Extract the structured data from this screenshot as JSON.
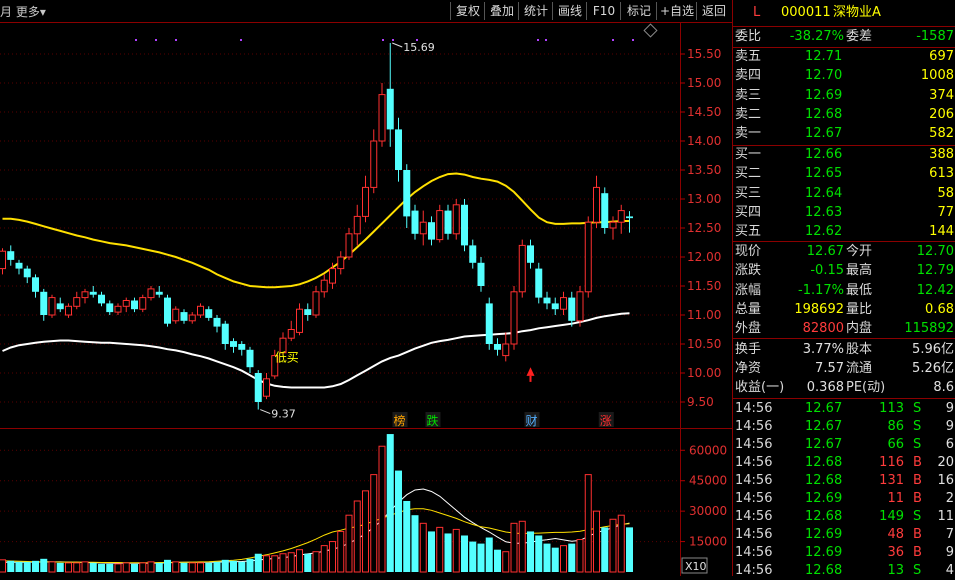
{
  "toolbar": {
    "left_fragment": "月",
    "more": "更多",
    "buttons": [
      "复权",
      "叠加",
      "统计",
      "画线",
      "F10",
      "标记",
      "+自选",
      "返回"
    ]
  },
  "stock": {
    "flag": "L",
    "code": "000011",
    "name": "深物业A"
  },
  "weibi": {
    "label": "委比",
    "value": "-38.27%",
    "label2": "委差",
    "value2": "-1587"
  },
  "asks": [
    {
      "label": "卖五",
      "price": "12.71",
      "vol": "697"
    },
    {
      "label": "卖四",
      "price": "12.70",
      "vol": "1008"
    },
    {
      "label": "卖三",
      "price": "12.69",
      "vol": "374"
    },
    {
      "label": "卖二",
      "price": "12.68",
      "vol": "206"
    },
    {
      "label": "卖一",
      "price": "12.67",
      "vol": "582"
    }
  ],
  "bids": [
    {
      "label": "买一",
      "price": "12.66",
      "vol": "388"
    },
    {
      "label": "买二",
      "price": "12.65",
      "vol": "613"
    },
    {
      "label": "买三",
      "price": "12.64",
      "vol": "58"
    },
    {
      "label": "买四",
      "price": "12.63",
      "vol": "77"
    },
    {
      "label": "买五",
      "price": "12.62",
      "vol": "144"
    }
  ],
  "quote": [
    {
      "l1": "现价",
      "v1": "12.67",
      "c1": "g",
      "l2": "今开",
      "v2": "12.70",
      "c2": "g"
    },
    {
      "l1": "涨跌",
      "v1": "-0.15",
      "c1": "g",
      "l2": "最高",
      "v2": "12.79",
      "c2": "g"
    },
    {
      "l1": "涨幅",
      "v1": "-1.17%",
      "c1": "g",
      "l2": "最低",
      "v2": "12.42",
      "c2": "g"
    },
    {
      "l1": "总量",
      "v1": "198692",
      "c1": "y",
      "l2": "量比",
      "v2": "0.68",
      "c2": "y"
    },
    {
      "l1": "外盘",
      "v1": "82800",
      "c1": "r",
      "l2": "内盘",
      "v2": "115892",
      "c2": "g"
    }
  ],
  "stats": [
    {
      "l1": "换手",
      "v1": "3.77%",
      "l2": "股本",
      "v2": "5.96亿"
    },
    {
      "l1": "净资",
      "v1": "7.57",
      "l2": "流通",
      "v2": "5.26亿"
    },
    {
      "l1": "收益(一)",
      "v1": "0.368",
      "l2": "PE(动)",
      "v2": "8.6"
    }
  ],
  "ticks": [
    {
      "t": "14:56",
      "p": "12.67",
      "v": "113",
      "s": "S",
      "n": "9"
    },
    {
      "t": "14:56",
      "p": "12.67",
      "v": "86",
      "s": "S",
      "n": "9"
    },
    {
      "t": "14:56",
      "p": "12.67",
      "v": "66",
      "s": "S",
      "n": "6"
    },
    {
      "t": "14:56",
      "p": "12.68",
      "v": "116",
      "s": "B",
      "n": "20"
    },
    {
      "t": "14:56",
      "p": "12.68",
      "v": "131",
      "s": "B",
      "n": "16"
    },
    {
      "t": "14:56",
      "p": "12.69",
      "v": "11",
      "s": "B",
      "n": "2"
    },
    {
      "t": "14:56",
      "p": "12.68",
      "v": "149",
      "s": "S",
      "n": "11"
    },
    {
      "t": "14:56",
      "p": "12.69",
      "v": "48",
      "s": "B",
      "n": "7"
    },
    {
      "t": "14:56",
      "p": "12.69",
      "v": "36",
      "s": "B",
      "n": "9"
    },
    {
      "t": "14:56",
      "p": "12.68",
      "v": "13",
      "s": "S",
      "n": "4"
    }
  ],
  "chart_data": {
    "type": "candlestick",
    "price_ylim": [
      9.3,
      15.8
    ],
    "price_ticks": [
      "15.50",
      "15.00",
      "14.50",
      "14.00",
      "13.50",
      "13.00",
      "12.50",
      "12.00",
      "11.50",
      "11.00",
      "10.50",
      "10.00",
      "9.50"
    ],
    "volume_ylim": [
      0,
      70000
    ],
    "volume_ticks": [
      "60000",
      "45000",
      "30000",
      "15000"
    ],
    "volume_unit": "X10",
    "high_annotation": "15.69",
    "low_annotation": "9.37",
    "signal_label": "低买",
    "event_markers": [
      "榜",
      "跌",
      "财",
      "涨"
    ],
    "candles": [
      [
        11.8,
        12.1,
        11.7,
        12.15
      ],
      [
        12.1,
        11.95,
        11.85,
        12.2
      ],
      [
        11.9,
        11.8,
        11.7,
        11.95
      ],
      [
        11.8,
        11.65,
        11.55,
        11.85
      ],
      [
        11.65,
        11.4,
        11.3,
        11.7
      ],
      [
        11.4,
        11.0,
        10.9,
        11.45
      ],
      [
        11.0,
        11.3,
        10.95,
        11.35
      ],
      [
        11.2,
        11.1,
        11.05,
        11.3
      ],
      [
        11.0,
        11.15,
        10.95,
        11.2
      ],
      [
        11.15,
        11.3,
        11.1,
        11.4
      ],
      [
        11.3,
        11.4,
        11.2,
        11.45
      ],
      [
        11.4,
        11.35,
        11.3,
        11.5
      ],
      [
        11.35,
        11.2,
        11.15,
        11.4
      ],
      [
        11.2,
        11.05,
        11.0,
        11.25
      ],
      [
        11.05,
        11.15,
        11.0,
        11.2
      ],
      [
        11.15,
        11.25,
        11.05,
        11.3
      ],
      [
        11.25,
        11.1,
        11.05,
        11.3
      ],
      [
        11.1,
        11.3,
        11.05,
        11.35
      ],
      [
        11.3,
        11.45,
        11.25,
        11.5
      ],
      [
        11.4,
        11.35,
        11.3,
        11.5
      ],
      [
        11.3,
        10.85,
        10.8,
        11.35
      ],
      [
        10.9,
        11.1,
        10.85,
        11.15
      ],
      [
        11.05,
        10.9,
        10.85,
        11.1
      ],
      [
        10.9,
        11.0,
        10.85,
        11.05
      ],
      [
        11.0,
        11.15,
        10.95,
        11.2
      ],
      [
        11.1,
        10.95,
        10.9,
        11.15
      ],
      [
        10.95,
        10.8,
        10.7,
        11.0
      ],
      [
        10.85,
        10.5,
        10.4,
        10.9
      ],
      [
        10.55,
        10.45,
        10.35,
        10.6
      ],
      [
        10.5,
        10.4,
        10.3,
        10.55
      ],
      [
        10.4,
        10.1,
        10.0,
        10.45
      ],
      [
        10.0,
        9.5,
        9.37,
        10.05
      ],
      [
        9.6,
        9.9,
        9.55,
        10.0
      ],
      [
        9.95,
        10.3,
        9.9,
        10.4
      ],
      [
        10.35,
        10.6,
        10.3,
        10.7
      ],
      [
        10.6,
        10.75,
        10.55,
        10.9
      ],
      [
        10.7,
        11.1,
        10.65,
        11.2
      ],
      [
        11.1,
        11.0,
        10.9,
        11.2
      ],
      [
        11.0,
        11.4,
        10.95,
        11.5
      ],
      [
        11.4,
        11.6,
        11.3,
        11.7
      ],
      [
        11.55,
        11.8,
        11.45,
        11.9
      ],
      [
        11.8,
        12.0,
        11.7,
        12.1
      ],
      [
        12.0,
        12.4,
        11.95,
        12.5
      ],
      [
        12.4,
        12.7,
        12.2,
        12.9
      ],
      [
        12.7,
        13.2,
        12.6,
        13.4
      ],
      [
        13.2,
        14.0,
        13.1,
        14.2
      ],
      [
        14.0,
        14.8,
        13.9,
        15.0
      ],
      [
        14.9,
        14.2,
        13.9,
        15.69
      ],
      [
        14.2,
        13.5,
        13.3,
        14.4
      ],
      [
        13.5,
        12.7,
        12.5,
        13.6
      ],
      [
        12.8,
        12.4,
        12.3,
        12.9
      ],
      [
        12.4,
        12.6,
        12.2,
        12.8
      ],
      [
        12.6,
        12.3,
        12.2,
        12.7
      ],
      [
        12.3,
        12.8,
        12.25,
        12.9
      ],
      [
        12.8,
        12.4,
        12.3,
        12.9
      ],
      [
        12.4,
        12.9,
        12.3,
        13.0
      ],
      [
        12.9,
        12.2,
        12.1,
        13.0
      ],
      [
        12.2,
        11.9,
        11.8,
        12.3
      ],
      [
        11.9,
        11.5,
        11.4,
        12.0
      ],
      [
        11.2,
        10.5,
        10.4,
        11.3
      ],
      [
        10.5,
        10.4,
        10.3,
        10.6
      ],
      [
        10.3,
        10.5,
        10.2,
        10.7
      ],
      [
        10.5,
        11.4,
        10.4,
        11.5
      ],
      [
        11.4,
        12.2,
        11.3,
        12.3
      ],
      [
        12.2,
        11.9,
        11.8,
        12.3
      ],
      [
        11.8,
        11.3,
        11.2,
        11.9
      ],
      [
        11.3,
        11.2,
        11.1,
        11.4
      ],
      [
        11.2,
        11.1,
        11.0,
        11.3
      ],
      [
        11.1,
        11.3,
        11.0,
        11.4
      ],
      [
        11.3,
        10.9,
        10.8,
        11.4
      ],
      [
        10.9,
        11.4,
        10.8,
        11.5
      ],
      [
        11.4,
        12.6,
        11.3,
        12.7
      ],
      [
        12.6,
        13.2,
        12.5,
        13.4
      ],
      [
        13.1,
        12.5,
        12.4,
        13.2
      ],
      [
        12.5,
        12.6,
        12.3,
        12.7
      ],
      [
        12.6,
        12.8,
        12.4,
        12.9
      ],
      [
        12.7,
        12.67,
        12.42,
        12.79
      ]
    ],
    "volumes": [
      6000,
      5500,
      5000,
      5000,
      5500,
      6500,
      5000,
      4500,
      4500,
      4500,
      5000,
      4500,
      4000,
      4000,
      4000,
      4500,
      4000,
      4500,
      5000,
      4500,
      6000,
      5000,
      4500,
      4500,
      4500,
      4500,
      5000,
      6000,
      5500,
      5000,
      6500,
      9000,
      8000,
      8000,
      9000,
      9500,
      11000,
      9000,
      10000,
      13000,
      15000,
      20000,
      28000,
      35000,
      40000,
      48000,
      62000,
      68000,
      50000,
      35000,
      28000,
      24000,
      20000,
      22000,
      19000,
      21000,
      18000,
      15000,
      14000,
      17000,
      11000,
      10000,
      24000,
      25000,
      20000,
      18000,
      14000,
      12000,
      13000,
      14000,
      16000,
      48000,
      30000,
      22000,
      26000,
      28000,
      22000
    ],
    "series": [
      {
        "name": "MA upper",
        "values": [
          12.66,
          12.66,
          12.64,
          12.61,
          12.57,
          12.53,
          12.49,
          12.45,
          12.41,
          12.37,
          12.34,
          12.3,
          12.27,
          12.24,
          12.22,
          12.2,
          12.17,
          12.14,
          12.11,
          12.08,
          12.04,
          12,
          11.95,
          11.9,
          11.84,
          11.78,
          11.7,
          11.64,
          11.58,
          11.54,
          11.5,
          11.49,
          11.48,
          11.48,
          11.49,
          11.5,
          11.53,
          11.58,
          11.64,
          11.72,
          11.82,
          11.92,
          12.04,
          12.17,
          12.3,
          12.44,
          12.58,
          12.72,
          12.86,
          13,
          13.12,
          13.22,
          13.31,
          13.38,
          13.43,
          13.44,
          13.42,
          13.38,
          13.35,
          13.33,
          13.3,
          13.23,
          13.12,
          12.97,
          12.82,
          12.68,
          12.6,
          12.57,
          12.57,
          12.58,
          12.58,
          12.59,
          12.6,
          12.6,
          12.61,
          12.62,
          12.62
        ]
      },
      {
        "name": "MA lower",
        "values": [
          10.38,
          10.44,
          10.48,
          10.5,
          10.52,
          10.54,
          10.55,
          10.56,
          10.56,
          10.55,
          10.54,
          10.53,
          10.52,
          10.52,
          10.51,
          10.5,
          10.49,
          10.48,
          10.46,
          10.44,
          10.41,
          10.39,
          10.36,
          10.32,
          10.29,
          10.25,
          10.2,
          10.15,
          10.1,
          10.04,
          9.96,
          9.88,
          9.82,
          9.78,
          9.76,
          9.75,
          9.75,
          9.75,
          9.75,
          9.75,
          9.77,
          9.81,
          9.88,
          9.96,
          10.04,
          10.12,
          10.2,
          10.26,
          10.3,
          10.36,
          10.42,
          10.47,
          10.52,
          10.55,
          10.57,
          10.6,
          10.63,
          10.64,
          10.65,
          10.66,
          10.67,
          10.68,
          10.69,
          10.72,
          10.74,
          10.77,
          10.79,
          10.81,
          10.83,
          10.85,
          10.88,
          10.91,
          10.95,
          10.98,
          11.0,
          11.02,
          11.03
        ]
      },
      {
        "name": "Vol MA1",
        "values": [
          4800,
          4800,
          4800,
          4900,
          4900,
          5000,
          5000,
          5000,
          4900,
          4800,
          4700,
          4600,
          4500,
          4400,
          4400,
          4400,
          4300,
          4300,
          4400,
          4400,
          4600,
          4700,
          4800,
          4800,
          4800,
          4800,
          4800,
          5000,
          5100,
          5200,
          5400,
          5900,
          6300,
          6700,
          7100,
          7600,
          8400,
          8900,
          9400,
          10300,
          11200,
          12400,
          14200,
          16300,
          18900,
          22100,
          25600,
          30100,
          34400,
          38100,
          40400,
          40900,
          39700,
          37300,
          33900,
          30400,
          27000,
          24300,
          21900,
          19700,
          17200,
          14900,
          14200,
          14200,
          14700,
          15500,
          15900,
          16500,
          15800,
          15200,
          15600,
          17600,
          19400,
          20600,
          21900,
          23300,
          24100
        ]
      },
      {
        "name": "Vol MA2",
        "values": [
          5500,
          5400,
          5300,
          5200,
          5100,
          5000,
          5000,
          4900,
          4900,
          4900,
          4800,
          4800,
          4700,
          4700,
          4700,
          4600,
          4600,
          4600,
          4600,
          4700,
          4700,
          4800,
          4800,
          4900,
          5000,
          5100,
          5300,
          5500,
          5800,
          6200,
          6900,
          7700,
          8500,
          9400,
          10400,
          11600,
          13000,
          14500,
          16200,
          18200,
          19700,
          20600,
          21700,
          22400,
          23600,
          25100,
          26400,
          28000,
          29300,
          30700,
          31200,
          31200,
          30400,
          29100,
          27800,
          26400,
          24800,
          23400,
          22300,
          21700,
          20700,
          19700,
          19200,
          19000,
          19100,
          19200,
          19300,
          19500,
          19500,
          19700,
          20100,
          20900,
          21500,
          22300,
          22900,
          23500,
          23800
        ]
      }
    ]
  }
}
